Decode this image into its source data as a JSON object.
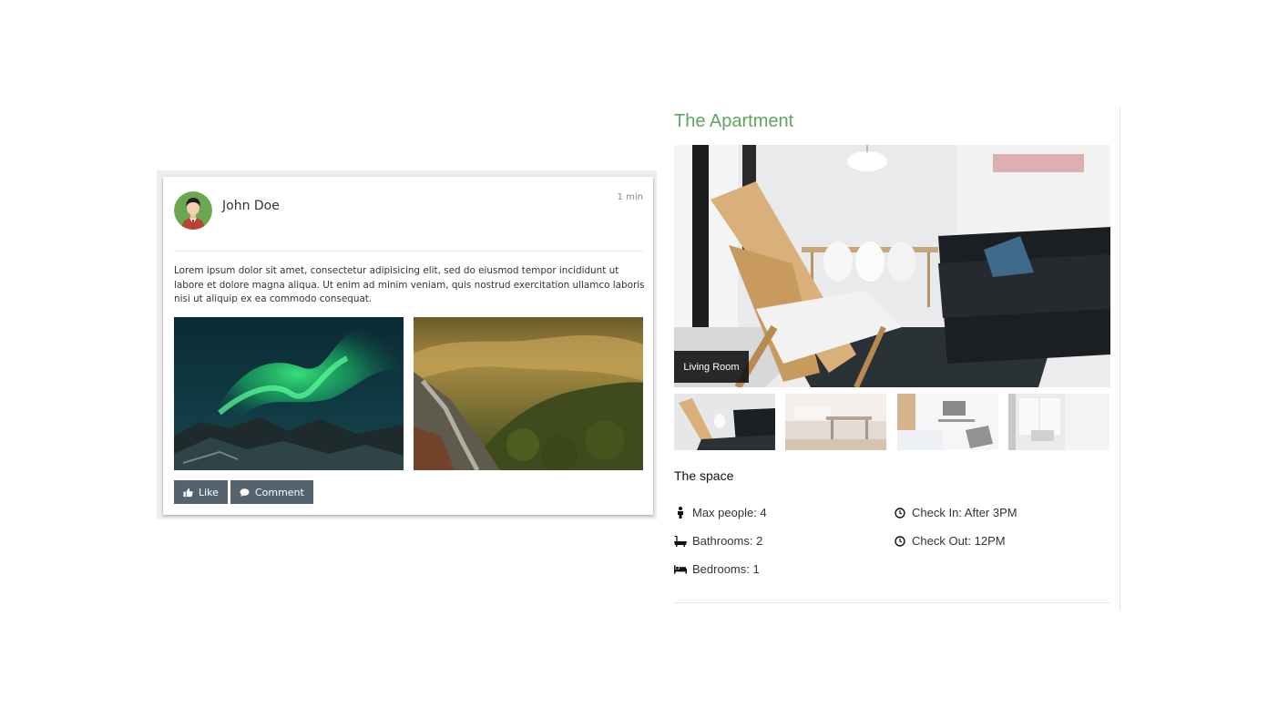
{
  "post": {
    "author": "John Doe",
    "time": "1 min",
    "body": "Lorem ipsum dolor sit amet, consectetur adipisicing elit, sed do eiusmod tempor incididunt ut labore et dolore magna aliqua. Ut enim ad minim veniam, quis nostrud exercitation ullamco laboris nisi ut aliquip ex ea commodo consequat.",
    "images": [
      "aurora-photo",
      "forest-valley-photo"
    ],
    "actions": {
      "like_label": "Like",
      "comment_label": "Comment"
    },
    "avatar_icon": "user-avatar",
    "colors": {
      "button": "#55636f",
      "avatar_bg": "#6aa84f"
    }
  },
  "apartment": {
    "title": "The Apartment",
    "main_image_caption": "Living Room",
    "thumbnails": [
      "living-room",
      "dining-room",
      "bedroom",
      "window-room"
    ],
    "space_heading": "The space",
    "amenities": {
      "max_people": "Max people: 4",
      "bathrooms": "Bathrooms: 2",
      "bedrooms": "Bedrooms: 1",
      "check_in": "Check In: After 3PM",
      "check_out": "Check Out: 12PM"
    },
    "colors": {
      "title": "#5aa85e"
    }
  }
}
